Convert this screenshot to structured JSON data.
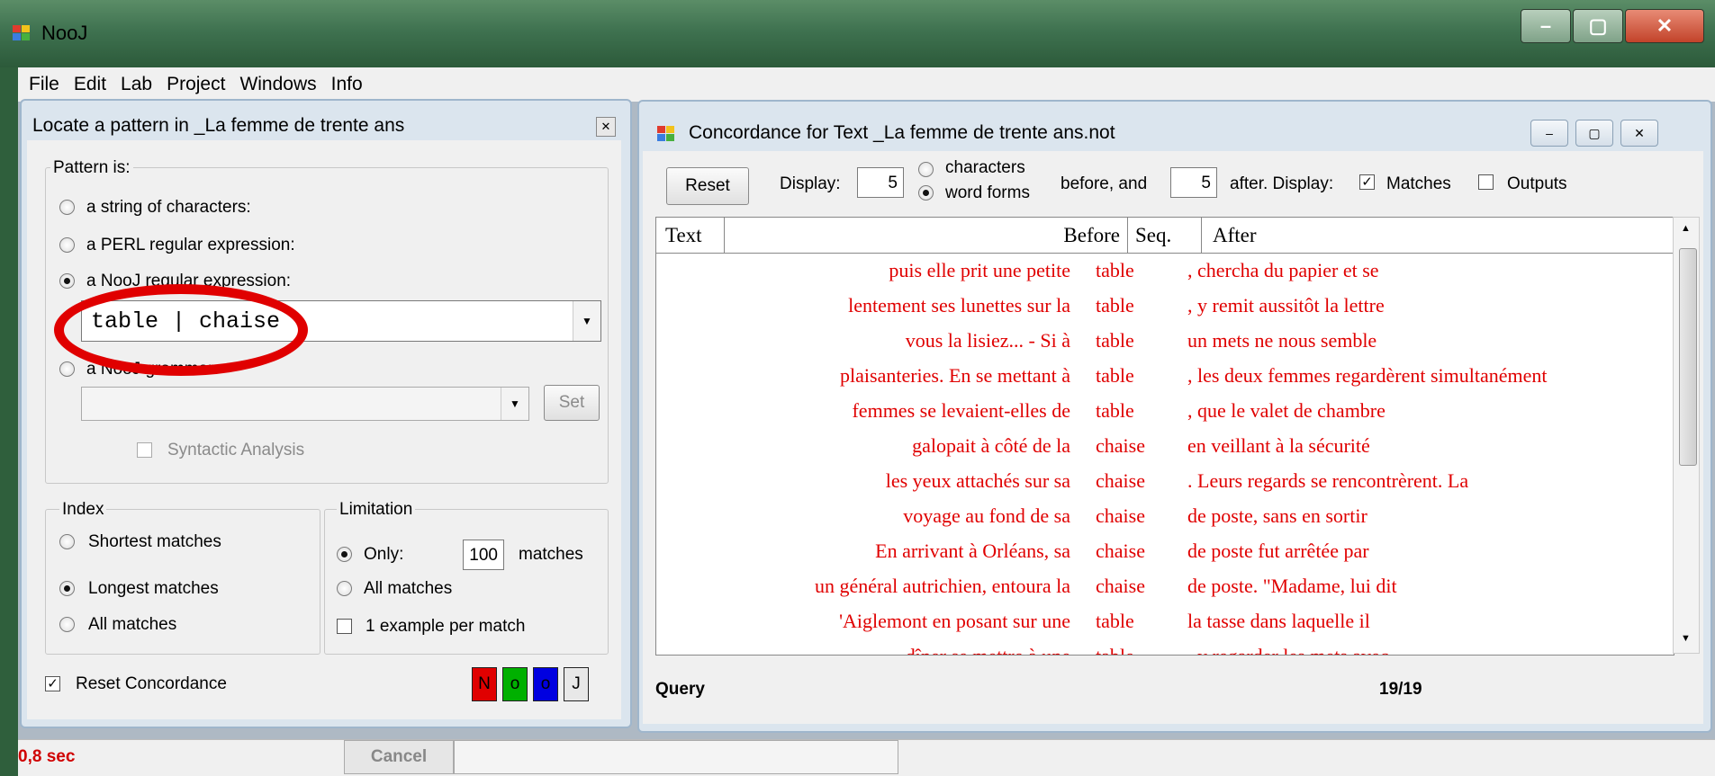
{
  "app": {
    "title": "NooJ"
  },
  "menu": [
    "File",
    "Edit",
    "Lab",
    "Project",
    "Windows",
    "Info"
  ],
  "locate": {
    "title": "Locate a pattern in _La femme de trente ans",
    "pattern_group": "Pattern is:",
    "pattern_options": [
      "a string of characters:",
      "a PERL regular expression:",
      "a NooJ regular expression:",
      "a NooJ grammar:"
    ],
    "pattern_selected": 2,
    "query_value": "table | chaise",
    "set_label": "Set",
    "syntactic_label": "Syntactic Analysis",
    "index_group": "Index",
    "index_options": [
      "Shortest matches",
      "Longest matches",
      "All matches"
    ],
    "index_selected": 1,
    "limitation_group": "Limitation",
    "limit_only_label": "Only:",
    "limit_value": "100",
    "limit_matches_label": "matches",
    "limit_all_label": "All matches",
    "example_label": "1 example per match",
    "reset_label": "Reset Concordance",
    "color_buttons": [
      {
        "label": "N",
        "color": "#e00000"
      },
      {
        "label": "o",
        "color": "#00b000"
      },
      {
        "label": "o",
        "color": "#0000e0"
      },
      {
        "label": "J",
        "color": "#e8e8e8"
      }
    ]
  },
  "concordance": {
    "title": "Concordance for Text _La femme de trente ans.not",
    "reset_label": "Reset",
    "display_label": "Display:",
    "before_value": "5",
    "unit_characters": "characters",
    "unit_word_forms": "word forms",
    "before_and": "before, and",
    "after_value": "5",
    "after_display": "after.  Display:",
    "matches_label": "Matches",
    "outputs_label": "Outputs",
    "columns": [
      "Text",
      "Before",
      "Seq.",
      "After"
    ],
    "rows": [
      {
        "before": "puis elle prit une petite",
        "seq": "table",
        "after": ", chercha du papier et se"
      },
      {
        "before": "lentement ses lunettes sur la",
        "seq": "table",
        "after": ", y remit aussitôt la lettre"
      },
      {
        "before": "vous la lisiez...  - Si à",
        "seq": "table",
        "after": "un mets ne nous semble"
      },
      {
        "before": "plaisanteries. En se mettant à",
        "seq": "table",
        "after": ", les deux femmes regardèrent simultanément"
      },
      {
        "before": "femmes se levaient-elles de",
        "seq": "table",
        "after": ", que le valet de chambre"
      },
      {
        "before": "galopait à côté de la",
        "seq": "chaise",
        "after": "en veillant à la sécurité"
      },
      {
        "before": "les yeux attachés sur sa",
        "seq": "chaise",
        "after": ". Leurs regards se rencontrèrent. La"
      },
      {
        "before": "voyage au fond de sa",
        "seq": "chaise",
        "after": "de poste, sans en sortir"
      },
      {
        "before": "En arrivant à Orléans, sa",
        "seq": "chaise",
        "after": "de poste fut arrêtée par"
      },
      {
        "before": "un général autrichien, entoura la",
        "seq": "chaise",
        "after": "de poste.  \"Madame, lui dit"
      },
      {
        "before": "'Aiglemont en posant sur une",
        "seq": "table",
        "after": "la tasse dans laquelle il"
      },
      {
        "before": "dîner se mettre à une",
        "seq": "table",
        "after": ", y regarder les mets avec"
      }
    ],
    "query_label": "Query",
    "count": "19/19"
  },
  "status": {
    "time": "0,8 sec",
    "cancel_label": "Cancel"
  }
}
